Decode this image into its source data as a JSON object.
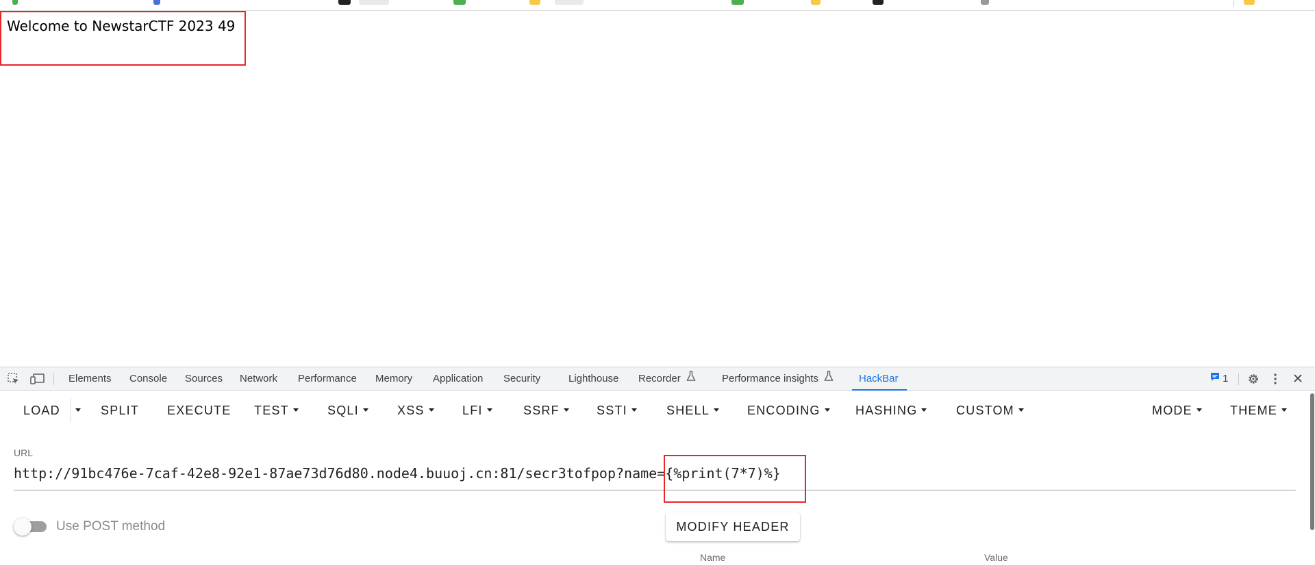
{
  "page": {
    "welcome_text": "Welcome to NewstarCTF 2023 49"
  },
  "devtools": {
    "tabs": [
      {
        "label": "Elements"
      },
      {
        "label": "Console"
      },
      {
        "label": "Sources"
      },
      {
        "label": "Network"
      },
      {
        "label": "Performance"
      },
      {
        "label": "Memory"
      },
      {
        "label": "Application"
      },
      {
        "label": "Security"
      },
      {
        "label": "Lighthouse"
      },
      {
        "label": "Recorder"
      },
      {
        "label": "Performance insights"
      },
      {
        "label": "HackBar"
      }
    ],
    "active_tab": "HackBar",
    "message_count": "1"
  },
  "hackbar": {
    "toolbar": {
      "load": "LOAD",
      "split": "SPLIT",
      "execute": "EXECUTE",
      "test": "TEST",
      "sqli": "SQLI",
      "xss": "XSS",
      "lfi": "LFI",
      "ssrf": "SSRF",
      "ssti": "SSTI",
      "shell": "SHELL",
      "encoding": "ENCODING",
      "hashing": "HASHING",
      "custom": "CUSTOM",
      "mode": "MODE",
      "theme": "THEME"
    },
    "url_label": "URL",
    "url_value": "http://91bc476e-7caf-42e8-92e1-87ae73d76d80.node4.buuoj.cn:81/secr3tofpop?name={%print(7*7)%}",
    "post_toggle_label": "Use POST method",
    "post_toggle_on": false,
    "modify_header": "MODIFY HEADER",
    "header_columns": {
      "name": "Name",
      "value": "Value"
    }
  },
  "colors": {
    "highlight": "#e5262a",
    "accent": "#1a73e8"
  }
}
